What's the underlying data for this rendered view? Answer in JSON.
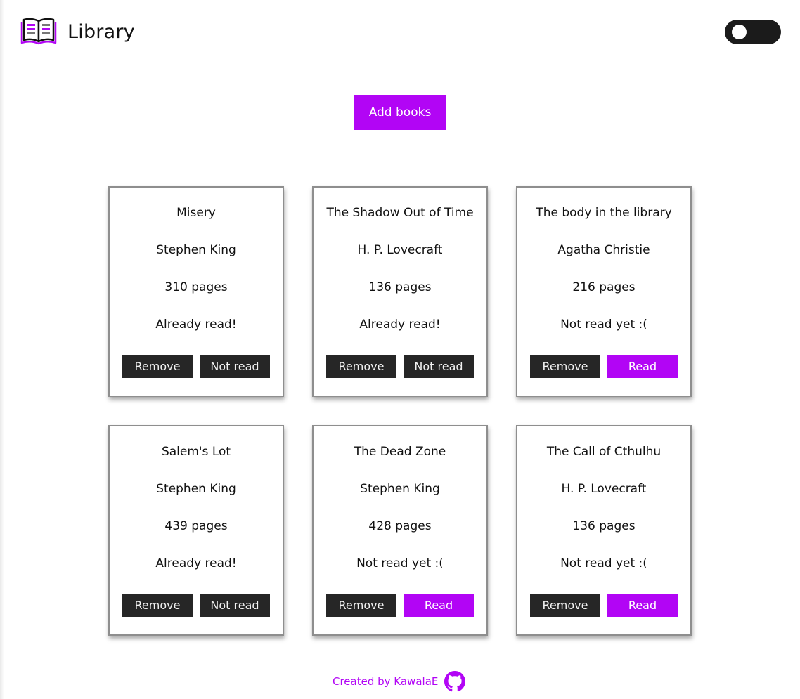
{
  "header": {
    "title": "Library",
    "logo_icon": "open-book-icon",
    "theme_toggle": {
      "state": "off"
    }
  },
  "actions": {
    "add_label": "Add books"
  },
  "books": [
    {
      "title": "Misery",
      "author": "Stephen King",
      "pages": "310 pages",
      "status": "Already read!",
      "remove_label": "Remove",
      "toggle_label": "Not read",
      "toggle_accent": false
    },
    {
      "title": "The Shadow Out of Time",
      "author": "H. P. Lovecraft",
      "pages": "136 pages",
      "status": "Already read!",
      "remove_label": "Remove",
      "toggle_label": "Not read",
      "toggle_accent": false
    },
    {
      "title": "The body in the library",
      "author": "Agatha Christie",
      "pages": "216 pages",
      "status": "Not read yet :(",
      "remove_label": "Remove",
      "toggle_label": "Read",
      "toggle_accent": true
    },
    {
      "title": "Salem's Lot",
      "author": "Stephen King",
      "pages": "439 pages",
      "status": "Already read!",
      "remove_label": "Remove",
      "toggle_label": "Not read",
      "toggle_accent": false
    },
    {
      "title": "The Dead Zone",
      "author": "Stephen King",
      "pages": "428 pages",
      "status": "Not read yet :(",
      "remove_label": "Remove",
      "toggle_label": "Read",
      "toggle_accent": true
    },
    {
      "title": "The Call of Cthulhu",
      "author": "H. P. Lovecraft",
      "pages": "136 pages",
      "status": "Not read yet :(",
      "remove_label": "Remove",
      "toggle_label": "Read",
      "toggle_accent": true
    }
  ],
  "footer": {
    "credit": "Created by KawalaE",
    "icon": "github-icon"
  },
  "colors": {
    "accent": "#b205f5",
    "button_dark": "#262626",
    "toggle_track": "#1b1b1b",
    "card_border": "#8e8e8e"
  }
}
